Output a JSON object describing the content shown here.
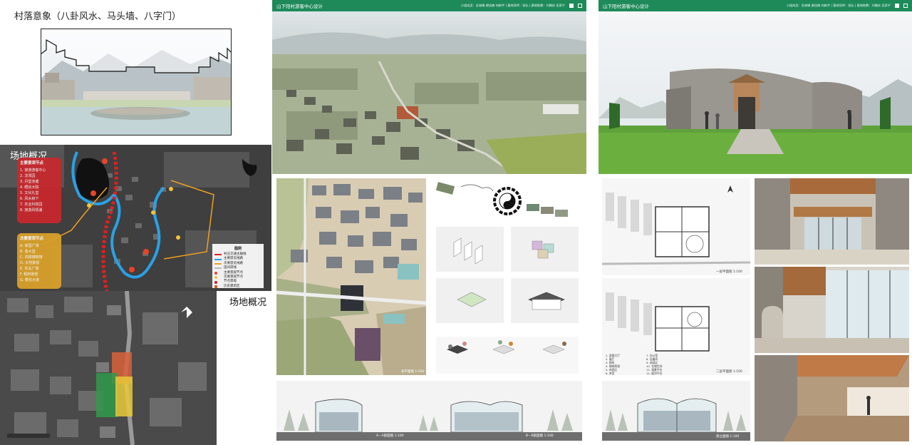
{
  "left": {
    "village_title": "村落意象（八卦风水、马头墙、八字门）",
    "site_title": "场地概况",
    "site_title_2": "场地概况",
    "main_nodes": {
      "title": "主要景观节点",
      "items": [
        "1.  旅游游客中心",
        "2.  龙须园",
        "3.  月堂池塘",
        "4.  晒谷大院",
        "5.  文化礼堂",
        "6.  风水树下",
        "7.  农业科技园",
        "8.  旅游风情湖"
      ]
    },
    "secondary_nodes": {
      "title": "次要景观节点",
      "items": [
        "A.  家园广场",
        "B.  金大堂",
        "C.  农耕博物馆",
        "D.  大地景观",
        "E.  农夫广场",
        "F.  稻田景观",
        "G.  樱花大道"
      ]
    },
    "legend": {
      "title": "图例",
      "items": [
        {
          "label": "村庄交通主轴线",
          "color": "#e02020"
        },
        {
          "label": "主要游览线路",
          "color": "#2aa1e6"
        },
        {
          "label": "次要游览线路",
          "color": "#f0a020"
        },
        {
          "label": "田间游线",
          "color": "#ffffff"
        },
        {
          "label": "主要景观节点",
          "color": "#e8442a"
        },
        {
          "label": "次要景观节点",
          "color": "#f5c23a"
        },
        {
          "label": "节点景观",
          "color": "#c82020"
        },
        {
          "label": "历史建筑区",
          "color": "#d86030"
        }
      ]
    },
    "colors": {
      "route_red": "#e02020",
      "route_blue": "#2aa1e6",
      "route_orange": "#f0a020",
      "lake": "#111111"
    }
  },
  "boards": {
    "project_title": "山下阳村游客中心设计",
    "credits": "小组成员：吴林娟 谢佳楠 何新宇  |  基地导师：张弘  |  基地助教：刘赐庆 吴家宁",
    "header_color": "#1e8a5a"
  },
  "middle": {
    "site_plan_caption": "总平面图 1:500",
    "section_a_caption": "A—A剖面图 1:100",
    "section_b_caption": "B—B剖面图 1:100",
    "diagram_icons": [
      "bagua-icon"
    ]
  },
  "right": {
    "plan1_caption": "一层平面图 1:100",
    "plan2_caption": "二层平面图 1:100",
    "section_caption": "南立面图 1:100",
    "plan_legend": [
      "1.  游客大厅",
      "2.  展厅",
      "3.  厕所",
      "4.  咖啡简餐",
      "5.  休息区",
      "6.  茶室",
      "7.  办公室",
      "8.  设备间",
      "9.  阅读区",
      "10. 仓储空间",
      "11. 观景平台",
      "12. 屋顶平台"
    ]
  }
}
